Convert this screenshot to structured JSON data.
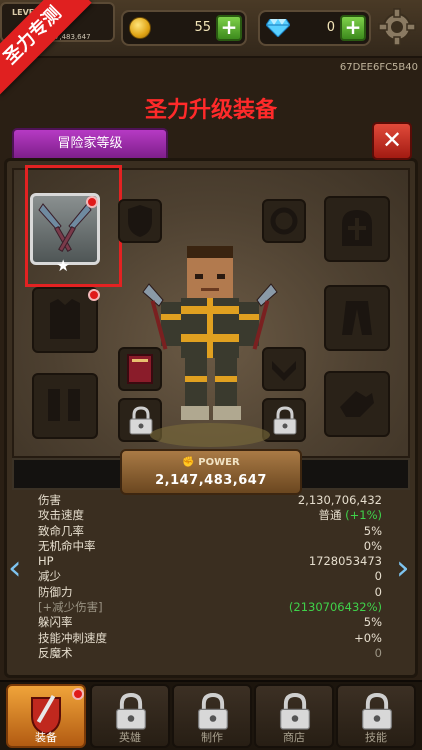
{
  "banner": "圣力专测",
  "header": {
    "level_label": "LEVEL",
    "level_value": "147,483,647",
    "coins": "55",
    "gems": "0",
    "uid": "67DEE6FC5B40"
  },
  "page_title": "圣力升级装备",
  "tab_label": "冒险家等级",
  "power": {
    "label": "POWER",
    "value": "2,147,483,647"
  },
  "stats": [
    {
      "label": "伤害",
      "value": "2,130,706,432"
    },
    {
      "label": "攻击速度",
      "value": "普通",
      "bonus": "(+1%)"
    },
    {
      "label": "致命几率",
      "value": "5%"
    },
    {
      "label": "无机命中率",
      "value": "0%"
    },
    {
      "label": "HP",
      "value": "1728053473"
    },
    {
      "label": "减少",
      "value": "0"
    },
    {
      "label": "防御力",
      "value": "0"
    },
    {
      "label": "[+减少伤害]",
      "value": "(2130706432%)"
    },
    {
      "label": "躲闪率",
      "value": "5%"
    },
    {
      "label": "技能冲刺速度",
      "value": "+0%"
    },
    {
      "label": "反魔术",
      "value": "0"
    }
  ],
  "nav": [
    {
      "label": "装备"
    },
    {
      "label": "英雄"
    },
    {
      "label": "制作"
    },
    {
      "label": "商店"
    },
    {
      "label": "技能"
    }
  ],
  "colors": {
    "title_red": "#ff2a2a",
    "tab_purple": "#9b2aa8",
    "stat_green": "#3fd24a"
  }
}
